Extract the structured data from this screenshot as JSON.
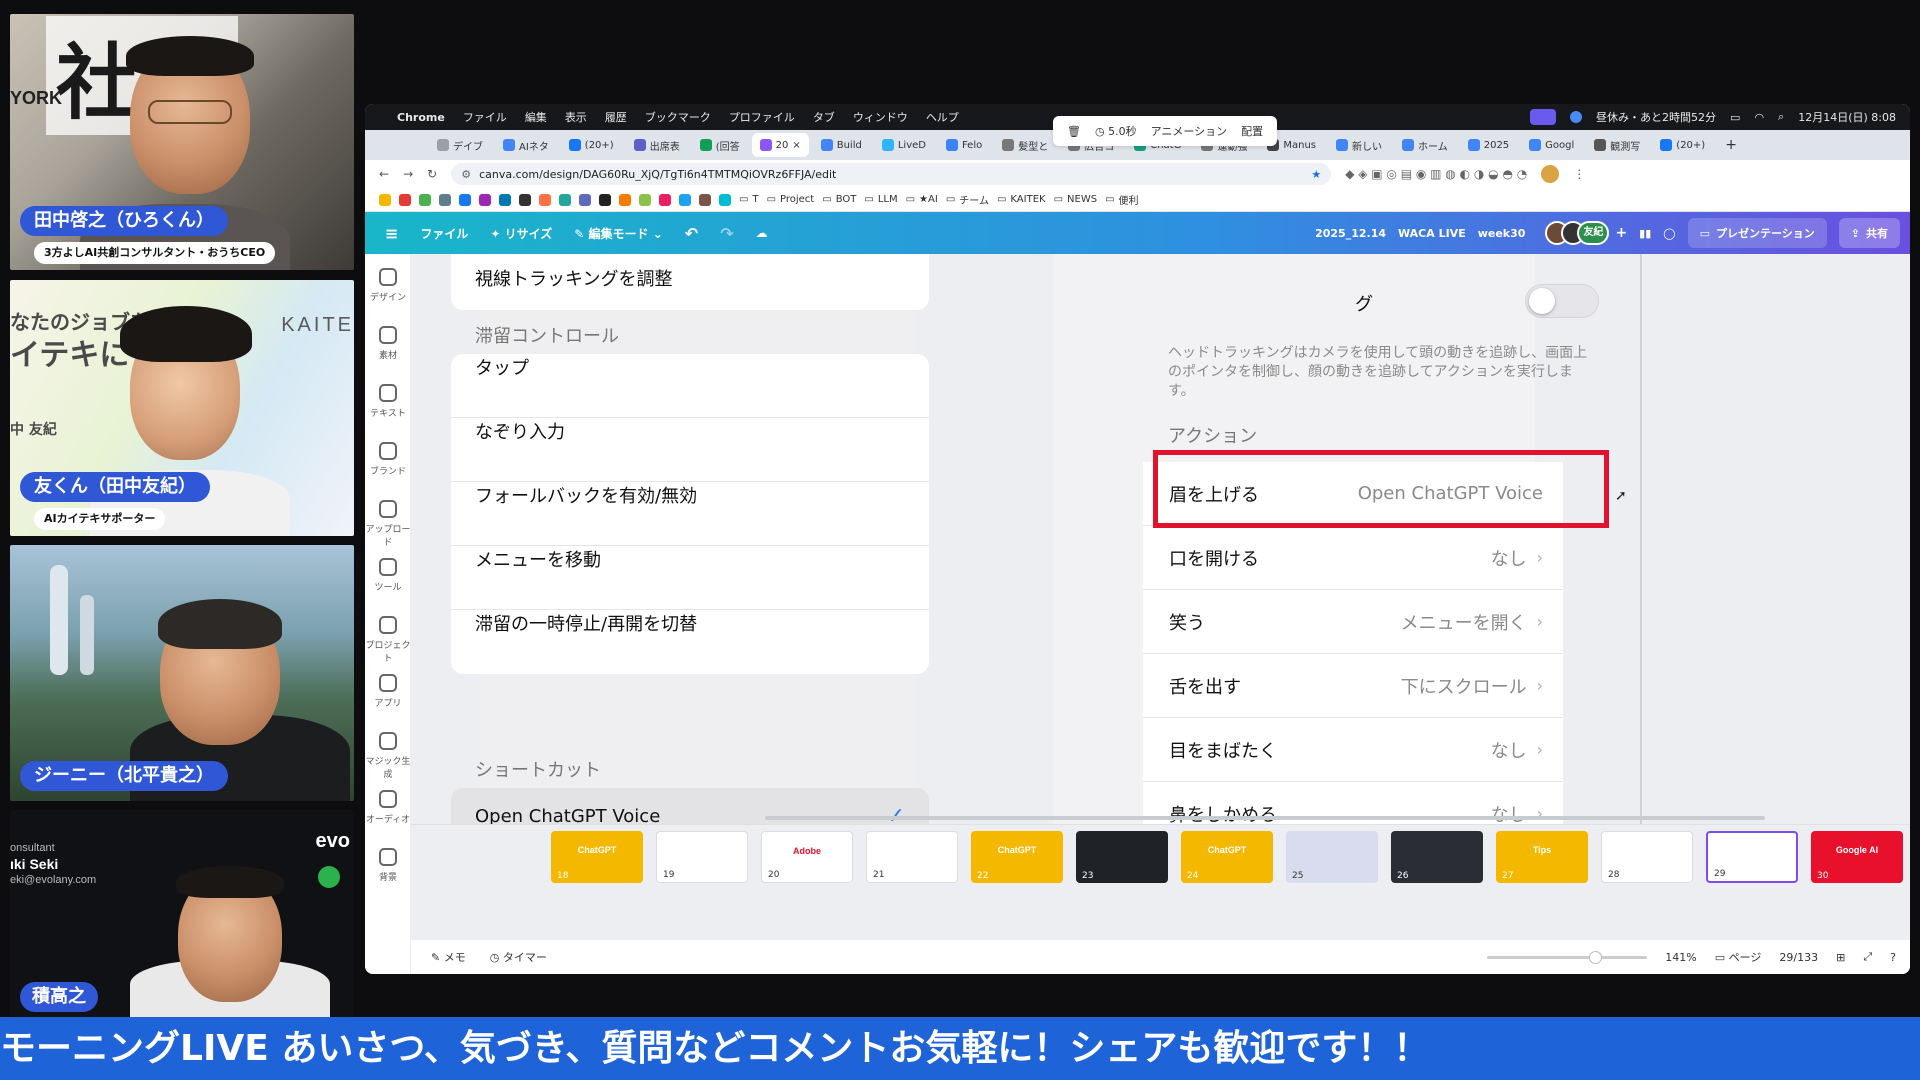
{
  "participants": [
    {
      "name": "田中啓之（ひろくん）",
      "role": "3方よしAI共創コンサルタント・おうちCEO",
      "sign": "社長",
      "sign2": "YORK"
    },
    {
      "name": "友くん（田中友紀）",
      "role": "AIカイテキサポーター",
      "poster1": "なたのジョブを",
      "poster2": "イテキに！",
      "poster3": "中 友紀",
      "brand": "KAITE"
    },
    {
      "name": "ジーニー（北平貴之）"
    },
    {
      "name": "積高之",
      "org_line1": "onsultant",
      "org_line2": "ıki Seki",
      "org_line3": "eki@evolany.com",
      "brand": "evo"
    }
  ],
  "menubar": {
    "app": "Chrome",
    "items": [
      "ファイル",
      "編集",
      "表示",
      "履歴",
      "ブックマーク",
      "プロファイル",
      "タブ",
      "ウィンドウ",
      "ヘルプ"
    ],
    "break_status": "昼休み・あと2時間52分",
    "datetime": "12月14日(日) 8:08"
  },
  "tabs": [
    "デイブ",
    "AIネタ",
    "(20+)",
    "出席表",
    "(回答",
    "20",
    "Build",
    "LiveD",
    "Felo",
    "髪型と",
    "広告コ",
    "ChatG",
    "運動強",
    "Manus",
    "新しい",
    "ホーム",
    "2025",
    "Googl",
    "観測写",
    "(20+)"
  ],
  "tab_colors": [
    "#9aa0a6",
    "#4285f4",
    "#1877f2",
    "#5b5fc7",
    "#0f9d58",
    "#8a56f5",
    "#4285f4",
    "#2fb5ff",
    "#3b82f6",
    "#777777",
    "#777777",
    "#10a37f",
    "#777777",
    "#444444",
    "#4285f4",
    "#4285f4",
    "#4285f4",
    "#4285f4",
    "#555555",
    "#1877f2"
  ],
  "active_tab_index": 5,
  "url": "canva.com/design/DAG60Ru_XjQ/TgTi6n4TMTMQiOVRz6FFJA/edit",
  "bookmark_folders": [
    "T",
    "Project",
    "BOT",
    "LLM",
    "★AI",
    "チーム",
    "KAITEK",
    "NEWS",
    "便利"
  ],
  "canva_toolbar": {
    "file": "ファイル",
    "resize": "リサイズ",
    "edit_mode": "編集モード",
    "date": "2025_12.14",
    "event": "WACA LIVE",
    "week": "week30",
    "avatar_label": "友紀",
    "present": "プレゼンテーション",
    "share": "共有"
  },
  "rail": [
    "デザイン",
    "素材",
    "テキスト",
    "ブランド",
    "アップロード",
    "ツール",
    "プロジェクト",
    "アプリ",
    "マジック生成",
    "オーディオ",
    "背景"
  ],
  "context_toolbar": {
    "duration": "5.0秒",
    "animation": "アニメーション",
    "arrange": "配置"
  },
  "left_panel": {
    "top_item": "視線トラッキングを調整",
    "dwell_section": "滞留コントロール",
    "dwell_items": [
      "タップ",
      "なぞり入力",
      "フォールバックを有効/無効",
      "メニューを移動",
      "滞留の一時停止/再開を切替"
    ],
    "shortcut_section": "ショートカット",
    "shortcut_selected": "Open ChatGPT Voice"
  },
  "right_panel": {
    "toggle_label_tail": "グ",
    "description": "ヘッドトラッキングはカメラを使用して頭の動きを追跡し、画面上のポインタを制御し、顔の動きを追跡してアクションを実行します。",
    "action_section": "アクション",
    "actions": [
      {
        "label": "眉を上げる",
        "value": "Open ChatGPT Voice"
      },
      {
        "label": "口を開ける",
        "value": "なし"
      },
      {
        "label": "笑う",
        "value": "メニューを開く"
      },
      {
        "label": "舌を出す",
        "value": "下にスクロール"
      },
      {
        "label": "目をまばたく",
        "value": "なし"
      },
      {
        "label": "鼻をしかめる",
        "value": "なし"
      }
    ]
  },
  "filmstrip": [
    {
      "num": "18",
      "text": "ChatGPT",
      "color": "#f5b800"
    },
    {
      "num": "19",
      "text": "",
      "color": "#ffffff"
    },
    {
      "num": "20",
      "text": "Adobe",
      "color": "#ffffff"
    },
    {
      "num": "21",
      "text": "",
      "color": "#ffffff"
    },
    {
      "num": "22",
      "text": "ChatGPT",
      "color": "#f5b800"
    },
    {
      "num": "23",
      "text": "",
      "color": "#1f2227"
    },
    {
      "num": "24",
      "text": "ChatGPT",
      "color": "#f5b800"
    },
    {
      "num": "25",
      "text": "",
      "color": "#d9dcef"
    },
    {
      "num": "26",
      "text": "",
      "color": "#2a2d33"
    },
    {
      "num": "27",
      "text": "Tips",
      "color": "#f5b800"
    },
    {
      "num": "28",
      "text": "",
      "color": "#ffffff"
    },
    {
      "num": "29",
      "text": "",
      "color": "#ffffff"
    },
    {
      "num": "30",
      "text": "Google AI",
      "color": "#e8102b"
    }
  ],
  "status_bar": {
    "memo": "メモ",
    "timer": "タイマー",
    "zoom": "141%",
    "page_label": "ページ",
    "page_count": "29/133"
  },
  "ticker": "モーニングLIVE あいさつ、気づき、質問などコメントお気軽に！シェアも歓迎です！！",
  "colors": {
    "canva_gradient_start": "#19b6c9",
    "canva_gradient_end": "#6a4fe0",
    "highlight": "#e0122d",
    "ticker": "#1f63d8",
    "name_tag": "#2f57d6"
  }
}
